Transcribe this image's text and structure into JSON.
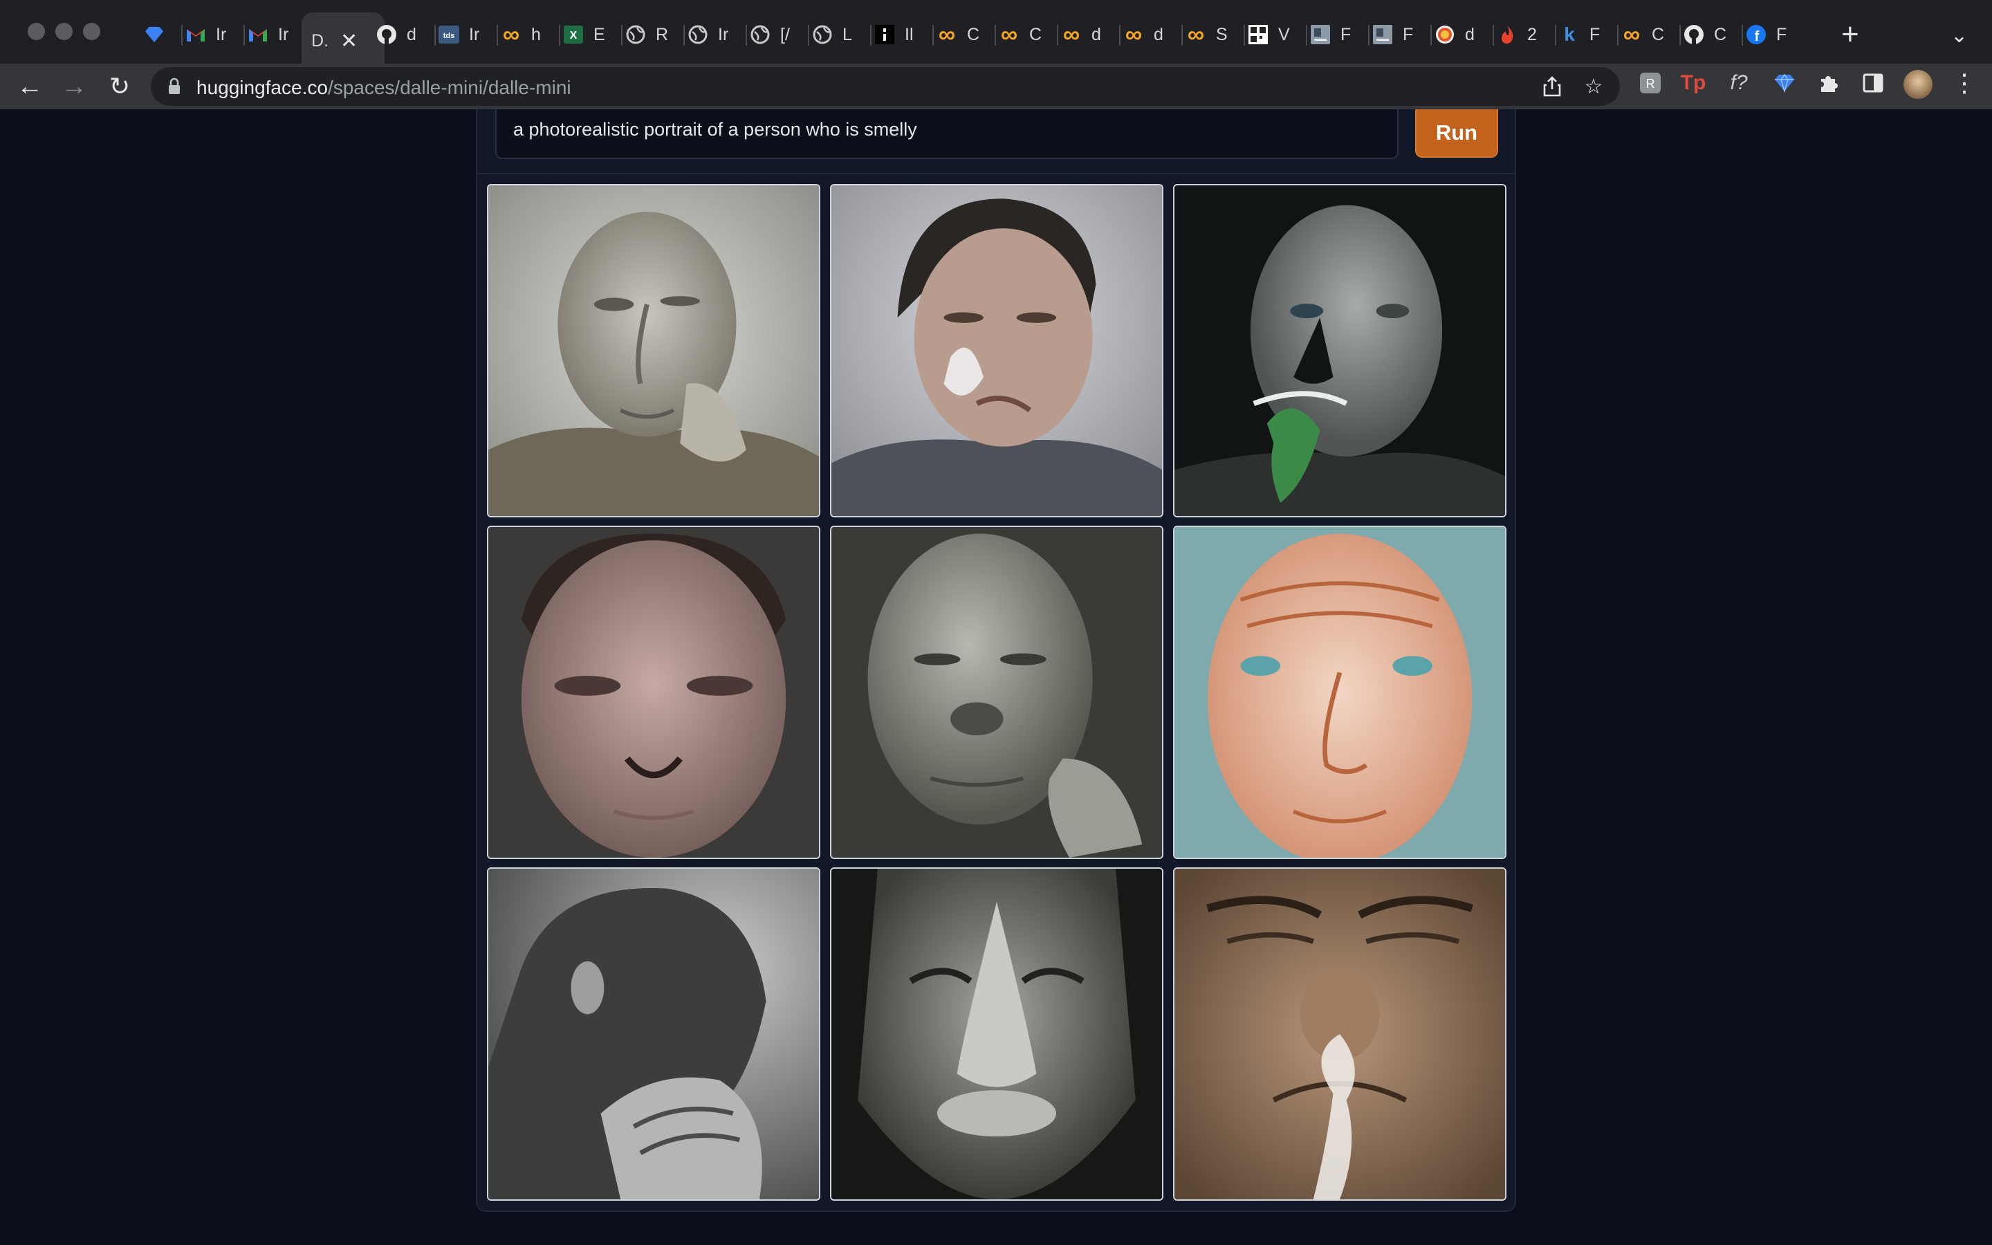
{
  "browser": {
    "tabs": [
      {
        "icon": "gem-icon",
        "title": ""
      },
      {
        "icon": "gmail-icon",
        "title": "Ir"
      },
      {
        "icon": "gmail-icon",
        "title": "Ir"
      },
      {
        "icon": "dalle-icon",
        "title": "D.",
        "active": true
      },
      {
        "icon": "github-icon",
        "title": "d"
      },
      {
        "icon": "tds-icon",
        "title": "Ir"
      },
      {
        "icon": "infinity-icon",
        "title": "h"
      },
      {
        "icon": "excel-icon",
        "title": "E"
      },
      {
        "icon": "globe-icon",
        "title": "R"
      },
      {
        "icon": "globe-icon",
        "title": "Ir"
      },
      {
        "icon": "globe-icon",
        "title": "[/"
      },
      {
        "icon": "globe-icon",
        "title": "L"
      },
      {
        "icon": "dots-icon",
        "title": "Il"
      },
      {
        "icon": "infinity-icon",
        "title": "C"
      },
      {
        "icon": "infinity-icon",
        "title": "C"
      },
      {
        "icon": "infinity-icon",
        "title": "d"
      },
      {
        "icon": "infinity-icon",
        "title": "d"
      },
      {
        "icon": "infinity-icon",
        "title": "S"
      },
      {
        "icon": "qr-icon",
        "title": "V"
      },
      {
        "icon": "doc-icon",
        "title": "F"
      },
      {
        "icon": "doc-icon",
        "title": "F"
      },
      {
        "icon": "rainbow-icon",
        "title": "d"
      },
      {
        "icon": "flame-icon",
        "title": "2"
      },
      {
        "icon": "k-icon",
        "title": "F"
      },
      {
        "icon": "infinity-icon",
        "title": "C"
      },
      {
        "icon": "github-icon",
        "title": "C"
      },
      {
        "icon": "facebook-icon",
        "title": "F"
      }
    ],
    "url_host": "huggingface.co",
    "url_path": "/spaces/dalle-mini/dalle-mini"
  },
  "app": {
    "prompt": "a photorealistic portrait  of a person who is smelly",
    "run_label": "Run",
    "accent_color": "#c2621d",
    "images": [
      {
        "alt": "generated-image-1"
      },
      {
        "alt": "generated-image-2"
      },
      {
        "alt": "generated-image-3"
      },
      {
        "alt": "generated-image-4"
      },
      {
        "alt": "generated-image-5"
      },
      {
        "alt": "generated-image-6"
      },
      {
        "alt": "generated-image-7"
      },
      {
        "alt": "generated-image-8"
      },
      {
        "alt": "generated-image-9"
      }
    ]
  }
}
